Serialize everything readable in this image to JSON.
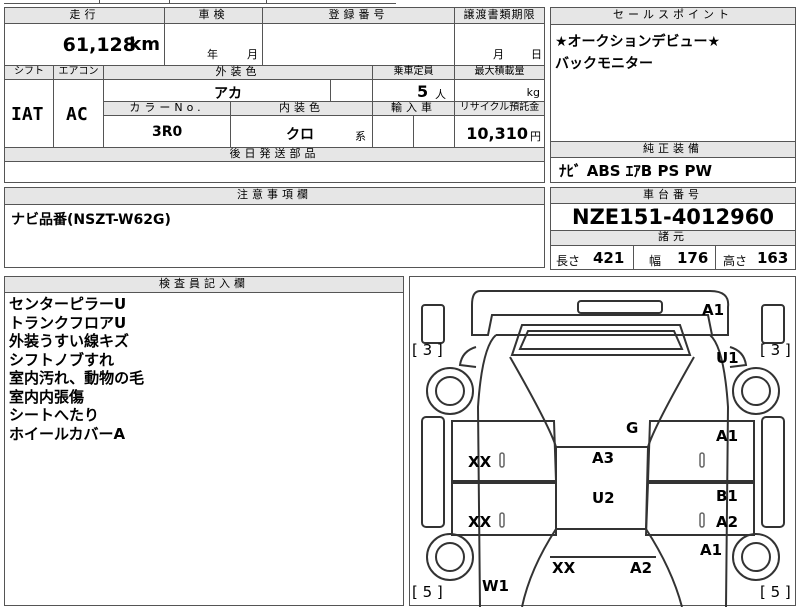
{
  "top_cut": {
    "c1": "",
    "c2": "",
    "c3": ""
  },
  "left_table": {
    "mileage_header": "走行",
    "inspection_header": "車検",
    "registration_header": "登録番号",
    "transfer_header": "譲渡書類期限",
    "mileage_value": "61,128",
    "mileage_unit": "km",
    "year_label": "年",
    "month_label": "月",
    "transfer_month": "月",
    "transfer_day": "日",
    "shift_header": "シフト",
    "ac_header": "エアコン",
    "exterior_header": "外装色",
    "capacity_header": "乗車定員",
    "load_header": "最大積載量",
    "shift_value": "IAT",
    "ac_value": "AC",
    "exterior_value": "アカ",
    "capacity_value": "5",
    "capacity_unit": "人",
    "load_unit": "kg",
    "color_no_header": "カラーNo.",
    "interior_header": "内装色",
    "import_header": "輸入車",
    "recycle_header": "リサイクル預託金",
    "color_no_value": "3R0",
    "interior_value": "クロ",
    "interior_suffix": "系",
    "recycle_value": "10,310",
    "recycle_unit": "円",
    "parts_header": "後日発送部品",
    "parts_value": ""
  },
  "sales_point": {
    "header": "セールスポイント",
    "lines": [
      "★オークションデビュー★",
      "バックモニター"
    ]
  },
  "standard_equipment": {
    "header": "純正装備",
    "value": "ﾅﾋﾞ ABS ｴｱB PS PW"
  },
  "notes": {
    "header": "注意事項欄",
    "value": "ナビ品番(NSZT-W62G)"
  },
  "chassis": {
    "header": "車台番号",
    "value": "NZE151-4012960"
  },
  "specs": {
    "header": "諸元",
    "length_label": "長さ",
    "length_value": "421",
    "width_label": "幅",
    "width_value": "176",
    "height_label": "高さ",
    "height_value": "163"
  },
  "inspector": {
    "header": "検査員記入欄",
    "lines": [
      "センターピラーU",
      "トランクフロアU",
      "外装うすい線キズ",
      "シフトノブすれ",
      "室内汚れ、動物の毛",
      "室内内張傷",
      "シートへたり",
      "ホイールカバーA"
    ]
  },
  "diagram": {
    "labels": {
      "a1_top": "A1",
      "u1": "U1",
      "bracket_tl": "[ 3 ]",
      "bracket_tr": "[ 3 ]",
      "g": "G",
      "a3": "A3",
      "xx_left1": "XX",
      "a1_right1": "A1",
      "u2": "U2",
      "xx_left2": "XX",
      "b1": "B1",
      "a2_right": "A2",
      "a1_right2": "A1",
      "xx_bottom": "XX",
      "a2_bottom": "A2",
      "w1": "W1",
      "bracket_bl": "[ 5 ]",
      "bracket_br": "[ 5 ]"
    }
  }
}
